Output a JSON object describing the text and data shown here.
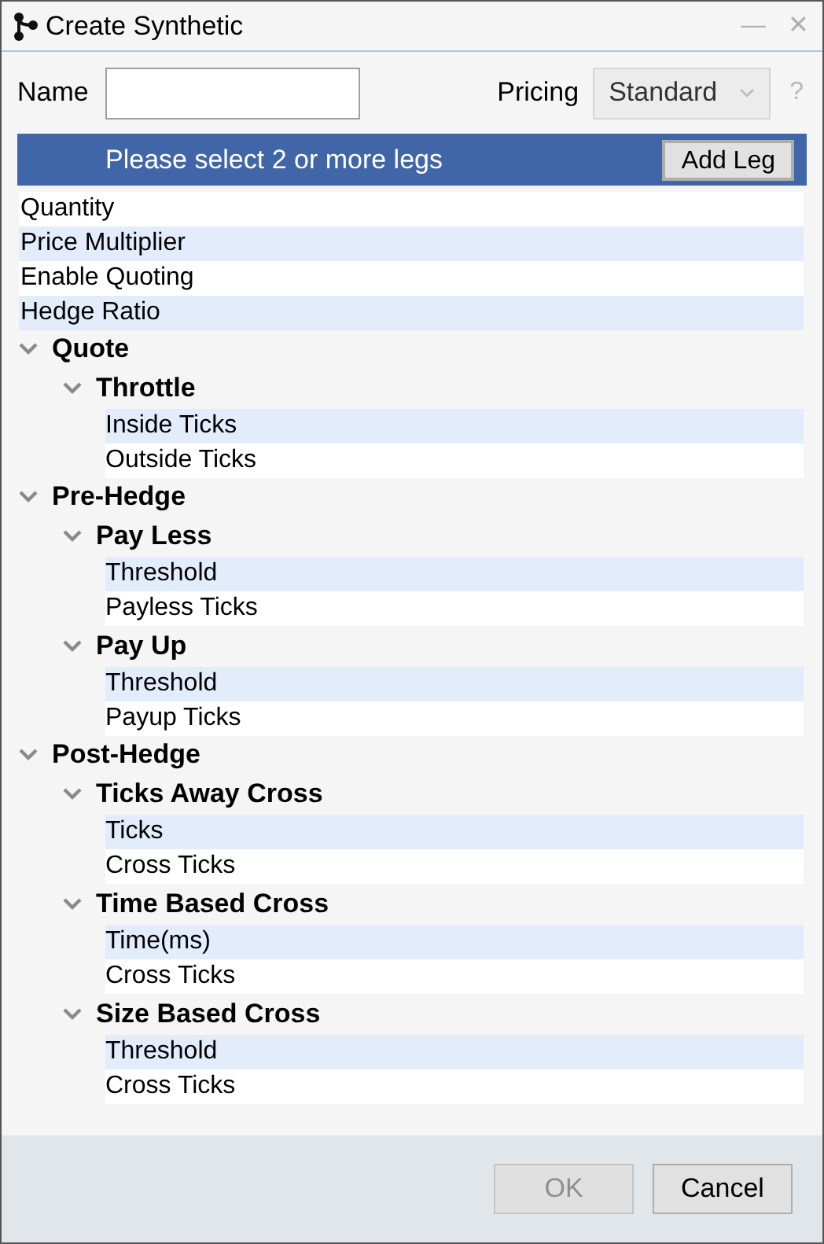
{
  "window": {
    "title": "Create Synthetic",
    "buttons": [
      "—",
      "✕"
    ]
  },
  "name_field": {
    "label": "Name"
  },
  "pricing": {
    "label": "Pricing",
    "value": "Standard",
    "disabled": true,
    "help": "?"
  },
  "legs_bar": {
    "message": "Please select 2 or more legs",
    "button": "Add Leg"
  },
  "fields": [
    "Quantity",
    "Price Multiplier",
    "Enable Quoting",
    "Hedge Ratio"
  ],
  "groups": [
    {
      "label": "Quote",
      "expanded": true,
      "children": [
        {
          "label": "Throttle",
          "expanded": true,
          "fields": [
            "Inside Ticks",
            "Outside Ticks"
          ]
        }
      ]
    },
    {
      "label": "Pre-Hedge",
      "expanded": true,
      "children": [
        {
          "label": "Pay Less",
          "expanded": true,
          "fields": [
            "Threshold",
            "Payless Ticks"
          ]
        },
        {
          "label": "Pay Up",
          "expanded": true,
          "fields": [
            "Threshold",
            "Payup Ticks"
          ]
        }
      ]
    },
    {
      "label": "Post-Hedge",
      "expanded": true,
      "children": [
        {
          "label": "Ticks Away Cross",
          "expanded": true,
          "fields": [
            "Ticks",
            "Cross Ticks"
          ]
        },
        {
          "label": "Time Based Cross",
          "expanded": true,
          "fields": [
            "Time(ms)",
            "Cross Ticks"
          ]
        },
        {
          "label": "Size Based Cross",
          "expanded": true,
          "fields": [
            "Threshold",
            "Cross Ticks"
          ]
        }
      ]
    }
  ],
  "footer": [
    {
      "label": "OK",
      "disabled": true
    },
    {
      "label": "Cancel",
      "disabled": false
    }
  ]
}
